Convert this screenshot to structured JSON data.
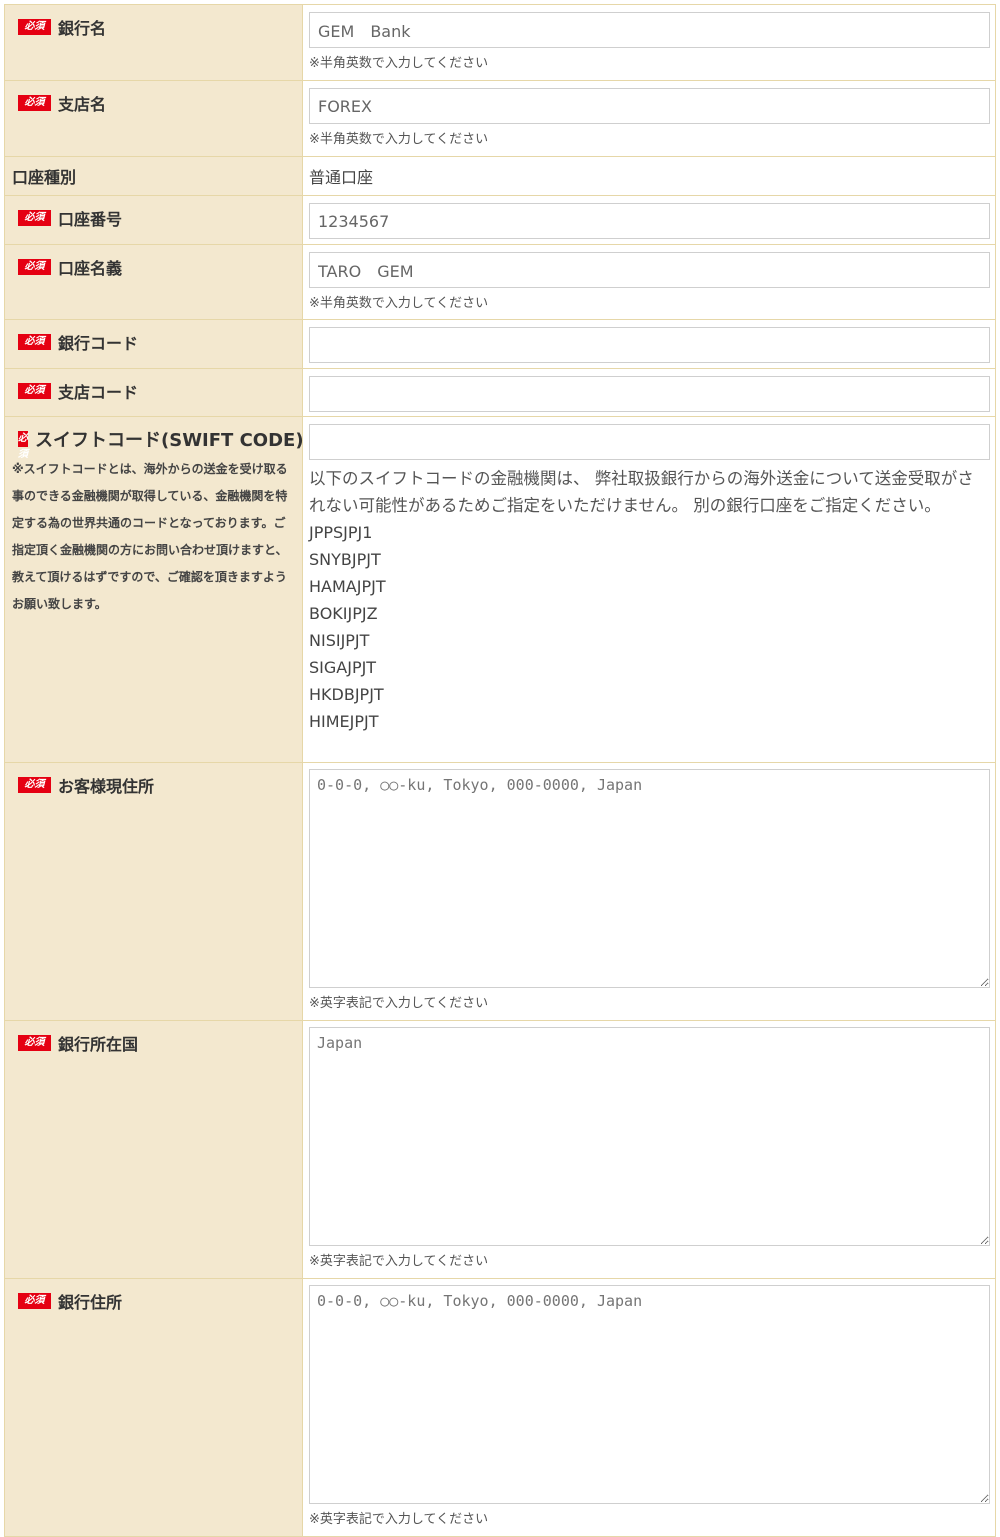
{
  "required_badge": "必須",
  "rows": {
    "bank_name": {
      "label": "銀行名",
      "value": "GEM　Bank",
      "hint": "※半角英数で入力してください"
    },
    "branch_name": {
      "label": "支店名",
      "value": "FOREX",
      "hint": "※半角英数で入力してください"
    },
    "account_type": {
      "label": "口座種別",
      "value": "普通口座"
    },
    "account_number": {
      "label": "口座番号",
      "value": "1234567"
    },
    "account_holder": {
      "label": "口座名義",
      "value": "TARO　GEM",
      "hint": "※半角英数で入力してください"
    },
    "bank_code": {
      "label": "銀行コード",
      "value": ""
    },
    "branch_code": {
      "label": "支店コード",
      "value": ""
    },
    "swift_code": {
      "label": "スイフトコード(SWIFT CODE)",
      "note": "※スイフトコードとは、海外からの送金を受け取る事のできる金融機関が取得している、金融機関を特定する為の世界共通のコードとなっております。ご指定頂く金融機関の方にお問い合わせ頂けますと、教えて頂けるはずですので、ご確認を頂きますようお願い致します。",
      "value": "",
      "message": "以下のスイフトコードの金融機関は、 弊社取扱銀行からの海外送金について送金受取がされない可能性があるためご指定をいただけません。 別の銀行口座をご指定ください。",
      "excluded": [
        "JPPSJPJ1",
        "SNYBJPJT",
        "HAMAJPJT",
        "BOKIJPJZ",
        "NISIJPJT",
        "SIGAJPJT",
        "HKDBJPJT",
        "HIMEJPJT"
      ]
    },
    "customer_address": {
      "label": "お客様現住所",
      "placeholder": "0-0-0, ○○-ku, Tokyo, 000-0000, Japan",
      "hint": "※英字表記で入力してください"
    },
    "bank_country": {
      "label": "銀行所在国",
      "placeholder": "Japan",
      "hint": "※英字表記で入力してください"
    },
    "bank_address": {
      "label": "銀行住所",
      "placeholder": "0-0-0, ○○-ku, Tokyo, 000-0000, Japan",
      "hint": "※英字表記で入力してください"
    }
  }
}
